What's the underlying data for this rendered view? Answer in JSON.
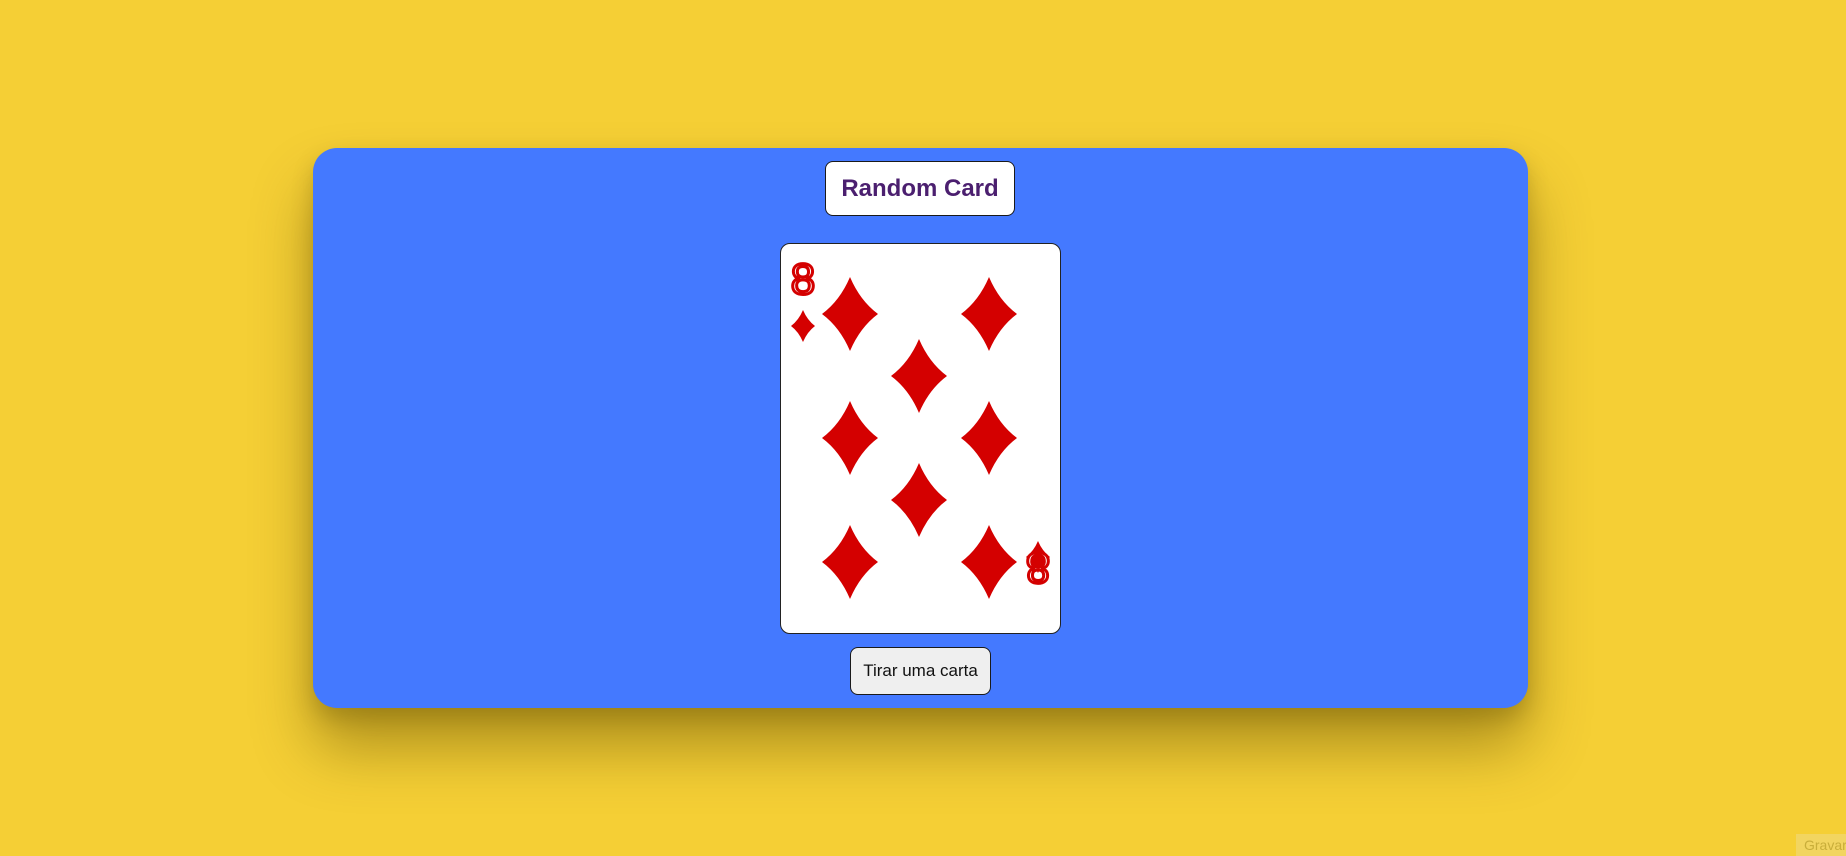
{
  "page": {
    "background_color": "#f5cf35",
    "panel_color": "#4479ff"
  },
  "header": {
    "title": "Random Card",
    "title_color": "#4b1f6f"
  },
  "card": {
    "rank": "8",
    "suit": "diamonds",
    "suit_icon": "diamond-icon",
    "color": "#d40000"
  },
  "actions": {
    "draw_button_label": "Tirar uma carta"
  },
  "footer": {
    "corner_label": "Gravar"
  }
}
